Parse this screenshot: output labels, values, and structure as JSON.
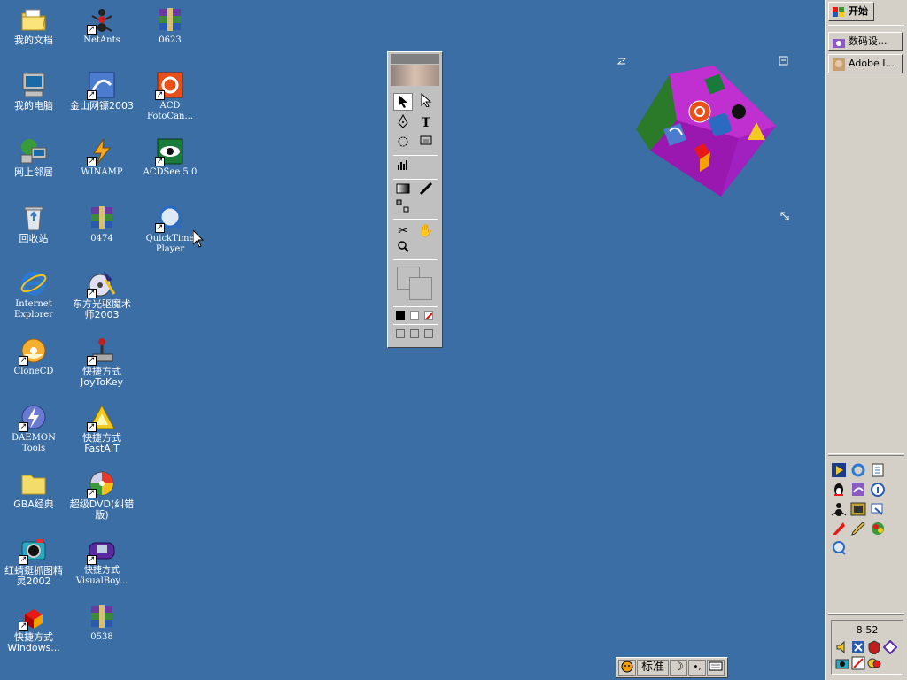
{
  "desktop": {
    "icons": [
      {
        "label": "我的文档",
        "icon": "my-documents-icon"
      },
      {
        "label": "NetAnts",
        "icon": "netants-icon"
      },
      {
        "label": "0623",
        "icon": "winrar-archive-icon"
      },
      {
        "label": "我的电脑",
        "icon": "my-computer-icon"
      },
      {
        "label": "金山网镖2003",
        "icon": "kingsoft-firewall-icon"
      },
      {
        "label": "ACD\nFotoCan...",
        "icon": "acd-fotocanvas-icon"
      },
      {
        "label": "网上邻居",
        "icon": "network-places-icon"
      },
      {
        "label": "WINAMP",
        "icon": "winamp-icon"
      },
      {
        "label": "ACDSee 5.0",
        "icon": "acdsee-icon"
      },
      {
        "label": "回收站",
        "icon": "recycle-bin-icon"
      },
      {
        "label": "0474",
        "icon": "winrar-archive-icon"
      },
      {
        "label": "QuickTime\nPlayer",
        "icon": "quicktime-icon"
      },
      {
        "label": "Internet\nExplorer",
        "icon": "internet-explorer-icon"
      },
      {
        "label": "东方光驱魔术\n师2003",
        "icon": "cd-magician-icon"
      },
      {
        "label": "CloneCD",
        "icon": "clonecd-icon"
      },
      {
        "label": "快捷方式\nJoyToKey",
        "icon": "joystick-icon"
      },
      {
        "label": "DAEMON Tools",
        "icon": "daemon-tools-icon"
      },
      {
        "label": "快捷方式\nFastAIT",
        "icon": "fastait-icon"
      },
      {
        "label": "GBA经典",
        "icon": "folder-icon"
      },
      {
        "label": "超级DVD(纠错\n版)",
        "icon": "dvd-player-icon"
      },
      {
        "label": "红蜻蜓抓图精\n灵2002",
        "icon": "screen-capture-icon"
      },
      {
        "label": "快捷方式\nVisualBoy...",
        "icon": "gameboy-emulator-icon"
      },
      {
        "label": "快捷方式\nWindows...",
        "icon": "windows-shortcut-icon"
      },
      {
        "label": "0538",
        "icon": "winrar-archive-icon"
      }
    ]
  },
  "taskbar": {
    "start_label": "开始",
    "windows": [
      {
        "label": "数码设...",
        "icon": "camera-app-icon"
      },
      {
        "label": "Adobe I...",
        "icon": "adobe-illustrator-icon"
      }
    ],
    "quicklaunch": [
      "media-player-icon",
      "ie-icon",
      "notepad-icon",
      "qq-icon",
      "kingsoft-icon",
      "info-icon",
      "netants-icon",
      "acdsee-icon",
      "network-icon",
      "flashget-icon",
      "pen-icon",
      "color-icon",
      "quicktime-icon"
    ],
    "clock": "8:52",
    "tray_icons": [
      "volume-icon",
      "network-status-icon",
      "shield-icon",
      "misc-icon",
      "camera-icon",
      "edit-icon",
      "chat-icon"
    ]
  },
  "ime": {
    "mode_label": "标准",
    "punct": "•,",
    "half_width": "☽"
  },
  "colors": {
    "desktop_bg": "#3a6ea5",
    "taskbar_bg": "#d4d0c8"
  }
}
